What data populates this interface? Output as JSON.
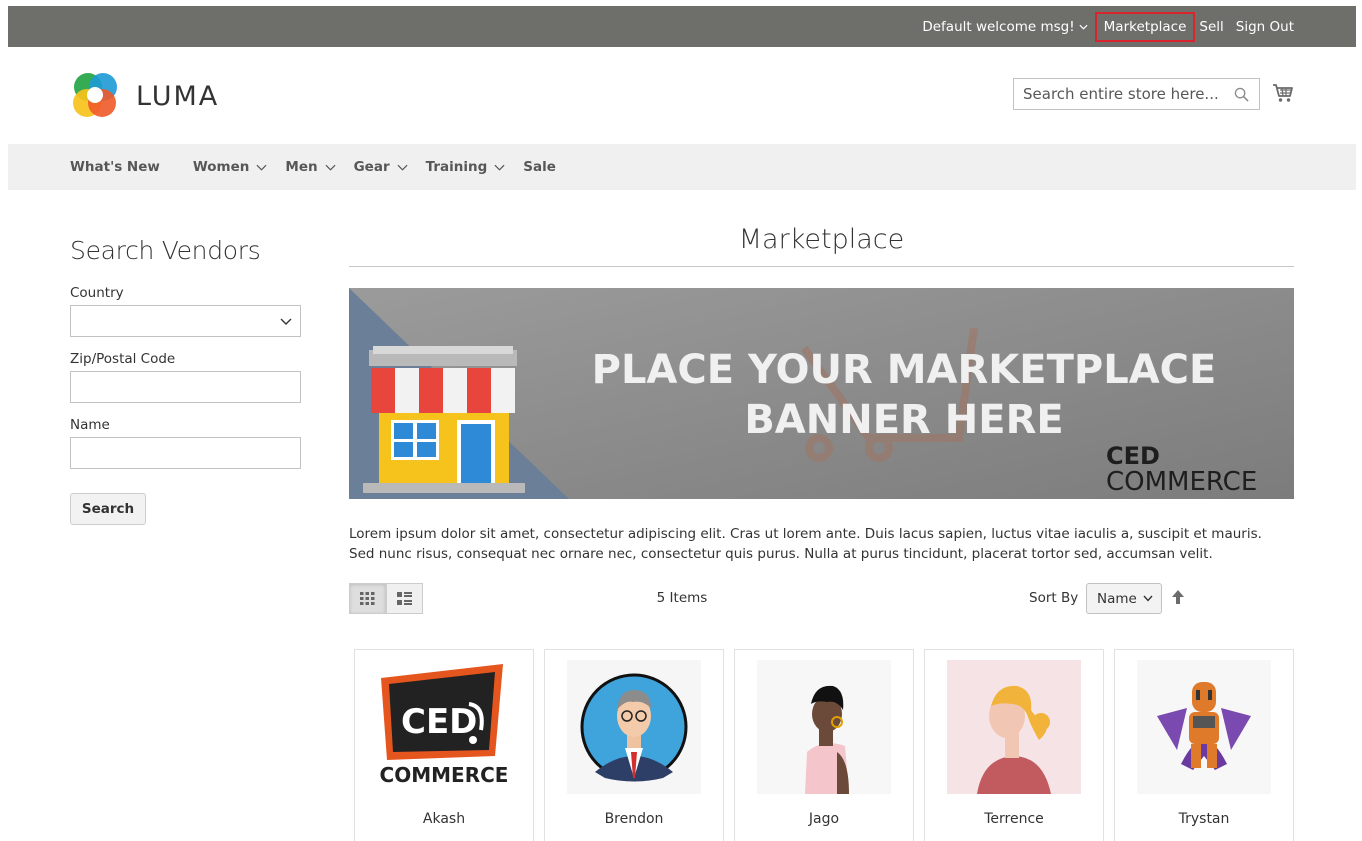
{
  "top_bar": {
    "welcome": "Default welcome msg!",
    "links": {
      "marketplace": "Marketplace",
      "sell": "Sell",
      "sign_out": "Sign Out"
    },
    "highlight_color": "#d9232d"
  },
  "header": {
    "logo_text": "LUMA",
    "search_placeholder": "Search entire store here...",
    "icons": {
      "search": "search-icon",
      "cart": "cart-icon"
    }
  },
  "nav": {
    "items": [
      "What's New",
      "Women",
      "Men",
      "Gear",
      "Training",
      "Sale"
    ]
  },
  "sidebar": {
    "title": "Search Vendors",
    "country_label": "Country",
    "country_value": "",
    "zip_label": "Zip/Postal Code",
    "name_label": "Name",
    "search_button": "Search"
  },
  "main": {
    "title": "Marketplace",
    "banner": {
      "headline_1": "PLACE YOUR MARKETPLACE",
      "headline_2": "BANNER HERE",
      "brand_1": "CED",
      "brand_2": "COMMERCE"
    },
    "description": "Lorem ipsum dolor sit amet, consectetur adipiscing elit. Cras ut lorem ante. Duis lacus sapien, luctus vitae iaculis a, suscipit et mauris. Sed nunc risus, consequat nec ornare nec, consectetur quis purus. Nulla at purus tincidunt, placerat tortor sed, accumsan velit.",
    "toolbar": {
      "items_count": "5 Items",
      "sort_label": "Sort By",
      "sort_value": "Name",
      "view_modes": [
        "grid-icon",
        "list-icon"
      ]
    },
    "vendors": [
      {
        "name": "Akash",
        "logo_text_1": "CED",
        "logo_text_2": "COMMERCE"
      },
      {
        "name": "Brendon"
      },
      {
        "name": "Jago"
      },
      {
        "name": "Terrence"
      },
      {
        "name": "Trystan"
      }
    ]
  }
}
